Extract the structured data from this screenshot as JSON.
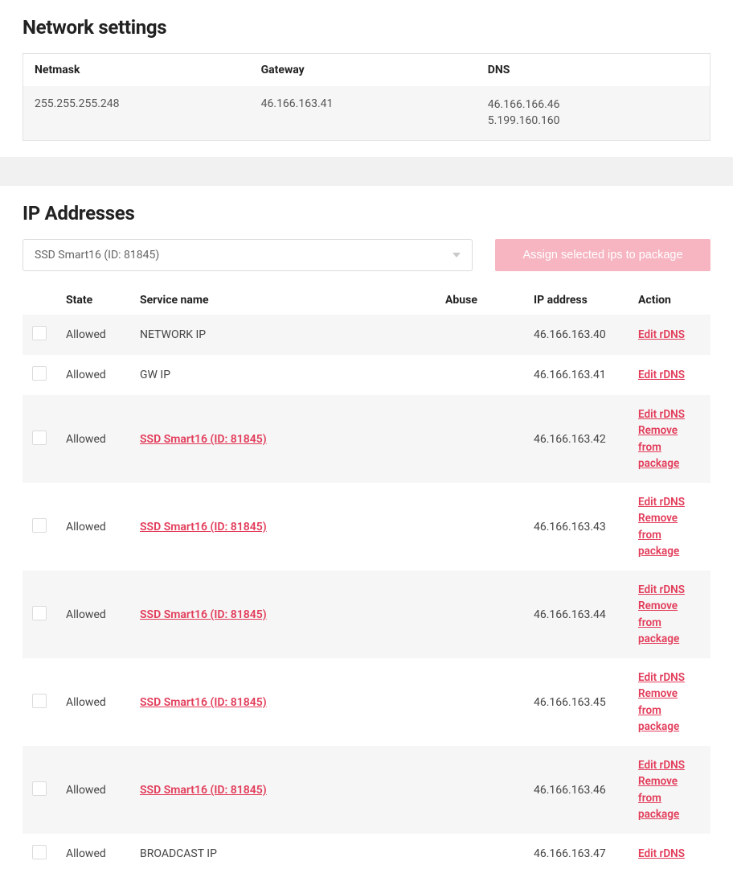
{
  "network": {
    "title": "Network settings",
    "headers": {
      "netmask": "Netmask",
      "gateway": "Gateway",
      "dns": "DNS"
    },
    "values": {
      "netmask": "255.255.255.248",
      "gateway": "46.166.163.41",
      "dns1": "46.166.166.46",
      "dns2": "5.199.160.160"
    }
  },
  "ip": {
    "title": "IP Addresses",
    "package_select": "SSD Smart16 (ID: 81845)",
    "assign_button": "Assign selected ips to package",
    "headers": {
      "state": "State",
      "service": "Service name",
      "abuse": "Abuse",
      "ipaddr": "IP address",
      "action": "Action"
    },
    "action_labels": {
      "edit_rdns": "Edit rDNS",
      "remove": "Remove from package"
    },
    "rows": [
      {
        "state": "Allowed",
        "service": "NETWORK IP",
        "service_link": false,
        "ip": "46.166.163.40",
        "removable": false
      },
      {
        "state": "Allowed",
        "service": "GW IP",
        "service_link": false,
        "ip": "46.166.163.41",
        "removable": false
      },
      {
        "state": "Allowed",
        "service": "SSD Smart16 (ID: 81845)",
        "service_link": true,
        "ip": "46.166.163.42",
        "removable": true
      },
      {
        "state": "Allowed",
        "service": "SSD Smart16 (ID: 81845)",
        "service_link": true,
        "ip": "46.166.163.43",
        "removable": true
      },
      {
        "state": "Allowed",
        "service": "SSD Smart16 (ID: 81845)",
        "service_link": true,
        "ip": "46.166.163.44",
        "removable": true
      },
      {
        "state": "Allowed",
        "service": "SSD Smart16 (ID: 81845)",
        "service_link": true,
        "ip": "46.166.163.45",
        "removable": true
      },
      {
        "state": "Allowed",
        "service": "SSD Smart16 (ID: 81845)",
        "service_link": true,
        "ip": "46.166.163.46",
        "removable": true
      },
      {
        "state": "Allowed",
        "service": "BROADCAST IP",
        "service_link": false,
        "ip": "46.166.163.47",
        "removable": false
      }
    ]
  }
}
